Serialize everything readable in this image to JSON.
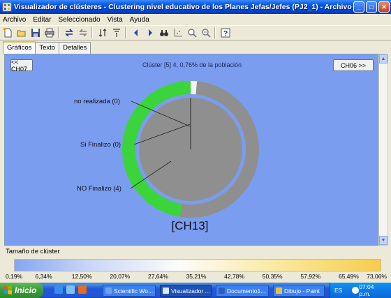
{
  "window": {
    "title": "Visualizador de clústeres - Clustering nivel educativo de los Planes Jefas/Jefes (PJ2_1) - Archivo local: general I...",
    "minimize_icon": "minimize-icon",
    "maximize_icon": "maximize-icon",
    "close_icon": "close-icon"
  },
  "menu": {
    "items": [
      "Archivo",
      "Editar",
      "Seleccionado",
      "Vista",
      "Ayuda"
    ]
  },
  "toolbar": {
    "icons": [
      "new-icon",
      "open-icon",
      "save-icon",
      "print-icon",
      "separator",
      "swap-icon",
      "swap-back-icon",
      "separator",
      "sort-icon",
      "filter-icon",
      "separator",
      "prev-icon",
      "next-icon",
      "binoculars-icon",
      "scatter-icon",
      "zoom-in-icon",
      "zoom-out-icon",
      "separator",
      "help-icon"
    ]
  },
  "tabs": [
    {
      "label": "Gráficos",
      "active": true
    },
    {
      "label": "Texto",
      "active": false
    },
    {
      "label": "Detalles",
      "active": false
    }
  ],
  "chart_panel": {
    "prev_button": "<< CH07",
    "next_button": "CH06 >>",
    "cluster_title": "Clúster [5] 4, 0,76% de la población",
    "cluster_label": "[CH13]",
    "background_color": "#7b9df0"
  },
  "chart_data": {
    "type": "pie",
    "variant": "donut-with-inner-pie",
    "title": "Clúster [5] 4, 0,76% de la población",
    "categories": [
      "no realizada",
      "Si Finalizo",
      "NO Finalizo"
    ],
    "legend_labels": [
      "no realizada (0)",
      "Si Finalizo (0)",
      "NO Finalizo (4)"
    ],
    "counts": [
      0,
      0,
      4
    ],
    "outer_ring": {
      "segments": [
        {
          "name": "white",
          "color": "#f4f4f4",
          "fraction": 0.015
        },
        {
          "name": "gray",
          "color": "#8f8f8f",
          "fraction": 0.51
        },
        {
          "name": "green",
          "color": "#3bd43b",
          "fraction": 0.475
        }
      ]
    },
    "inner_pie": {
      "color": "#8f8f8f",
      "fraction": 1.0
    }
  },
  "size_scale": {
    "label": "Tamaño de clúster",
    "ticks": [
      "0,19%",
      "6,34%",
      "12,50%",
      "20,07%",
      "27,64%",
      "35,21%",
      "42,78%",
      "50,35%",
      "57,92%",
      "65,49%",
      "73,06%"
    ]
  },
  "taskbar": {
    "start_label": "Inicio",
    "buttons": [
      {
        "label": "Scientific Wo...",
        "active": false,
        "color": "#6fa0e8"
      },
      {
        "label": "Visualizador ...",
        "active": true,
        "color": "#d9e8ff"
      },
      {
        "label": "Documento1...",
        "active": false,
        "color": "#2b5eb8"
      },
      {
        "label": "Dibujo - Paint",
        "active": false,
        "color": "#e8c040"
      }
    ],
    "language": "ES",
    "clock": "07:04 p.m."
  }
}
